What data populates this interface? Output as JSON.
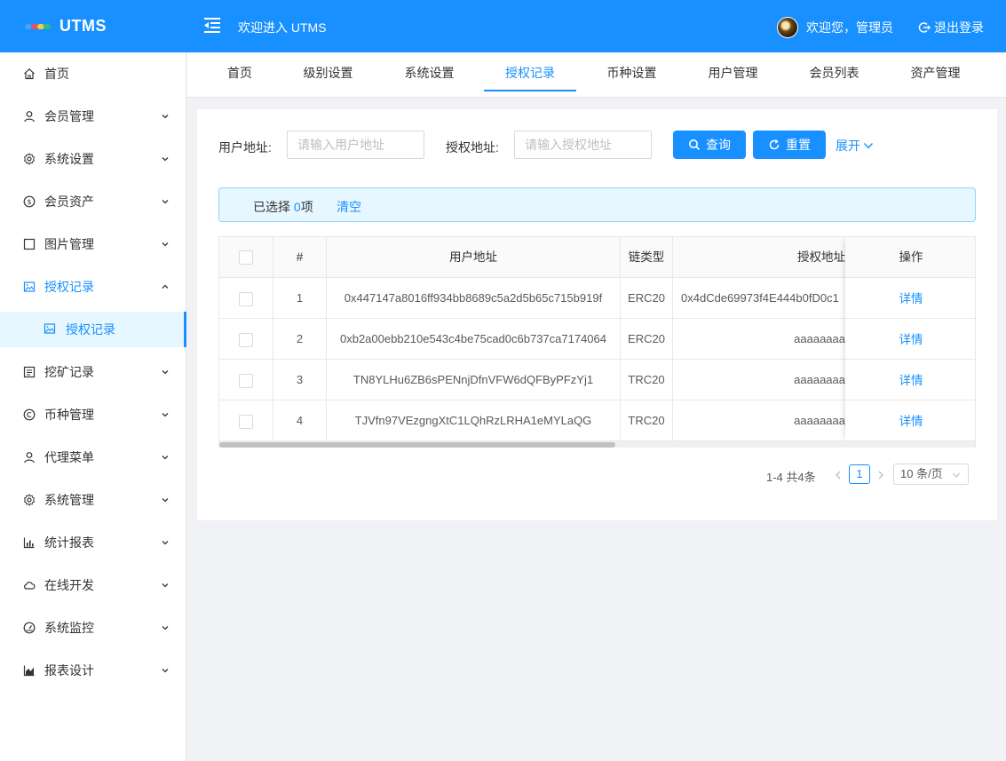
{
  "app": {
    "logo_text": "UTMS",
    "welcome_title": "欢迎进入 UTMS"
  },
  "user": {
    "greeting": "欢迎您，管理员",
    "logout_label": "退出登录"
  },
  "colors": {
    "primary": "#1890ff",
    "header_bg": "#1890ff",
    "selected_bg": "#e6f7ff"
  },
  "sidebar": {
    "items": [
      {
        "label": "首页",
        "icon": "home-icon"
      },
      {
        "label": "会员管理",
        "icon": "user-icon"
      },
      {
        "label": "系统设置",
        "icon": "gear-icon"
      },
      {
        "label": "会员资产",
        "icon": "dollar-circle-icon"
      },
      {
        "label": "图片管理",
        "icon": "square-icon"
      },
      {
        "label": "授权记录",
        "icon": "picture-icon",
        "expanded": true
      },
      {
        "label": "挖矿记录",
        "icon": "list-icon"
      },
      {
        "label": "币种管理",
        "icon": "copyright-icon"
      },
      {
        "label": "代理菜单",
        "icon": "user-icon"
      },
      {
        "label": "系统管理",
        "icon": "gear-icon"
      },
      {
        "label": "统计报表",
        "icon": "bar-chart-icon"
      },
      {
        "label": "在线开发",
        "icon": "cloud-icon"
      },
      {
        "label": "系统监控",
        "icon": "dashboard-icon"
      },
      {
        "label": "报表设计",
        "icon": "area-chart-icon"
      }
    ],
    "sub_item": {
      "label": "授权记录",
      "icon": "picture-icon"
    }
  },
  "tabs": [
    "首页",
    "级别设置",
    "系统设置",
    "授权记录",
    "币种设置",
    "用户管理",
    "会员列表",
    "资产管理"
  ],
  "active_tab": "授权记录",
  "filters": {
    "user_address": {
      "label": "用户地址:",
      "placeholder": "请输入用户地址",
      "value": ""
    },
    "auth_address": {
      "label": "授权地址:",
      "placeholder": "请输入授权地址",
      "value": ""
    },
    "query_label": "查询",
    "reset_label": "重置",
    "expand_label": "展开"
  },
  "selection": {
    "prefix": "已选择 ",
    "count": "0",
    "suffix": "项",
    "clear_label": "清空"
  },
  "table": {
    "columns": [
      "#",
      "用户地址",
      "链类型",
      "授权地址",
      "操作"
    ],
    "rows": [
      {
        "index": "1",
        "user_address": "0x447147a8016ff934bb8689c5a2d5b65c715b919f",
        "chain": "ERC20",
        "auth_address": "0x4dCde69973f4E444b0fD0c1",
        "action": "详情"
      },
      {
        "index": "2",
        "user_address": "0xb2a00ebb210e543c4be75cad0c6b737ca7174064",
        "chain": "ERC20",
        "auth_address": "aaaaaaaa",
        "action": "详情"
      },
      {
        "index": "3",
        "user_address": "TN8YLHu6ZB6sPENnjDfnVFW6dQFByPFzYj1",
        "chain": "TRC20",
        "auth_address": "aaaaaaaa",
        "action": "详情"
      },
      {
        "index": "4",
        "user_address": "TJVfn97VEzgngXtC1LQhRzLRHA1eMYLaQG",
        "chain": "TRC20",
        "auth_address": "aaaaaaaa",
        "action": "详情"
      }
    ]
  },
  "pagination": {
    "total_text": "1-4 共4条",
    "current_page": "1",
    "page_size": "10 条/页"
  }
}
